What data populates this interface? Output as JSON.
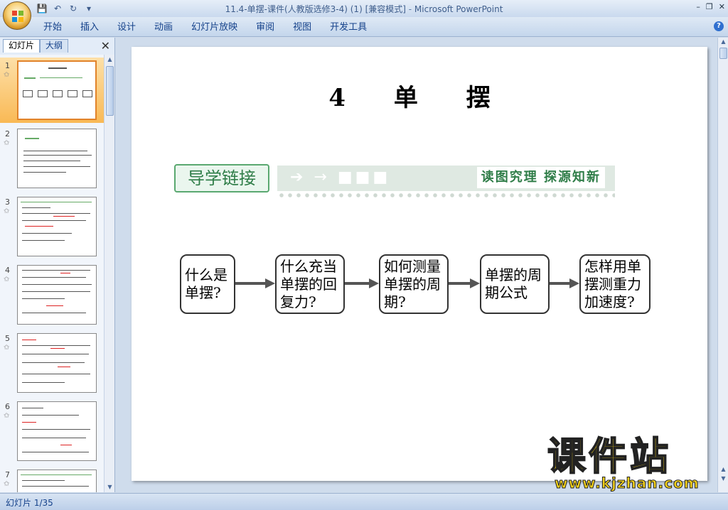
{
  "window": {
    "title": "11.4-单摆-课件(人教版选修3-4) (1) [兼容模式]",
    "title_sep": " - ",
    "app_name": "Microsoft PowerPoint",
    "minimize": "–",
    "restore": "❐",
    "close": "✕"
  },
  "qat": {
    "save_icon": "💾",
    "undo_icon": "↶",
    "redo_icon": "↻",
    "more_icon": "▾"
  },
  "ribbon": {
    "tabs": [
      "开始",
      "插入",
      "设计",
      "动画",
      "幻灯片放映",
      "审阅",
      "视图",
      "开发工具"
    ],
    "help": "?"
  },
  "left_panel": {
    "tabs": [
      "幻灯片",
      "大纲"
    ],
    "close": "✕",
    "thumbnails": [
      {
        "number": "1",
        "selected": true
      },
      {
        "number": "2",
        "selected": false
      },
      {
        "number": "3",
        "selected": false
      },
      {
        "number": "4",
        "selected": false
      },
      {
        "number": "5",
        "selected": false
      },
      {
        "number": "6",
        "selected": false
      },
      {
        "number": "7",
        "selected": false
      }
    ],
    "star": "✩"
  },
  "slide": {
    "title": "4 单 摆",
    "banner_left": "导学链接",
    "banner_right": "读图究理 探源知新",
    "banner_arrows": "➔ → ■■■",
    "flow": [
      "什么是单摆?",
      "什么充当单摆的回复力?",
      "如何测量单摆的周期?",
      "单摆的周期公式",
      "怎样用单摆测重力加速度?"
    ]
  },
  "status": {
    "slide_counter": "幻灯片 1/35"
  },
  "watermark": {
    "main": "课件站",
    "url": "www.kjzhan.com"
  },
  "colors": {
    "accent_green": "#2f7d48",
    "selected_thumb": "#f9b955",
    "ribbon_text": "#15428b"
  }
}
